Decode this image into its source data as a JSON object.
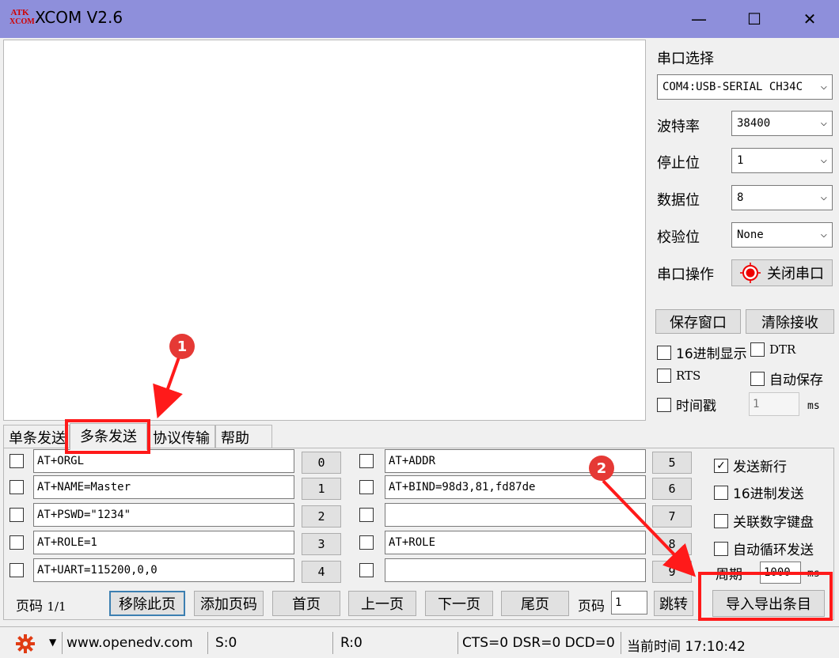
{
  "window": {
    "title": "XCOM V2.6",
    "logo_line1": "ATK",
    "logo_line2": "XCOM",
    "min": "—",
    "max": "☐",
    "close": "✕"
  },
  "side": {
    "port_label": "串口选择",
    "port_value": "COM4:USB-SERIAL CH34C",
    "baud_label": "波特率",
    "baud_value": "38400",
    "stop_label": "停止位",
    "stop_value": "1",
    "data_label": "数据位",
    "data_value": "8",
    "parity_label": "校验位",
    "parity_value": "None",
    "op_label": "串口操作",
    "op_button": "关闭串口",
    "save_window": "保存窗口",
    "clear_recv": "清除接收",
    "hex_display": "16进制显示",
    "dtr": "DTR",
    "rts": "RTS",
    "auto_save": "自动保存",
    "timestamp": "时间戳",
    "timestamp_value": "1",
    "ms": "ms"
  },
  "tabs": [
    "单条发送",
    "多条发送",
    "协议传输",
    "帮助"
  ],
  "left_rows": [
    {
      "text": "AT+ORGL",
      "num": "0"
    },
    {
      "text": "AT+NAME=Master",
      "num": "1"
    },
    {
      "text": "AT+PSWD=\"1234\"",
      "num": "2"
    },
    {
      "text": "AT+ROLE=1",
      "num": "3"
    },
    {
      "text": "AT+UART=115200,0,0",
      "num": "4"
    }
  ],
  "right_rows": [
    {
      "text": "AT+ADDR",
      "num": "5"
    },
    {
      "text": "AT+BIND=98d3,81,fd87de",
      "num": "6"
    },
    {
      "text": "",
      "num": "7"
    },
    {
      "text": "AT+ROLE",
      "num": "8"
    },
    {
      "text": "",
      "num": "9"
    }
  ],
  "options": {
    "send_newline": "发送新行",
    "hex_send": "16进制发送",
    "num_keypad": "关联数字键盘",
    "auto_loop": "自动循环发送",
    "period": "周期",
    "period_value": "1000",
    "ms": "ms"
  },
  "pager": {
    "page_label": "页码",
    "page_value": "1/1",
    "remove": "移除此页",
    "add": "添加页码",
    "first": "首页",
    "prev": "上一页",
    "next": "下一页",
    "last": "尾页",
    "page_label2": "页码",
    "page_input": "1",
    "jump": "跳转",
    "import_export": "导入导出条目"
  },
  "status": {
    "url": "www.openedv.com",
    "sent": "S:0",
    "recv": "R:0",
    "lines": "CTS=0 DSR=0 DCD=0",
    "time": "当前时间 17:10:42"
  },
  "annotations": {
    "badge1": "1",
    "badge2": "2"
  },
  "colors": {
    "titlebar": "#8e8fdb",
    "highlight": "#ff1a1a",
    "badge": "#e53935",
    "gear": "#e03c14"
  }
}
